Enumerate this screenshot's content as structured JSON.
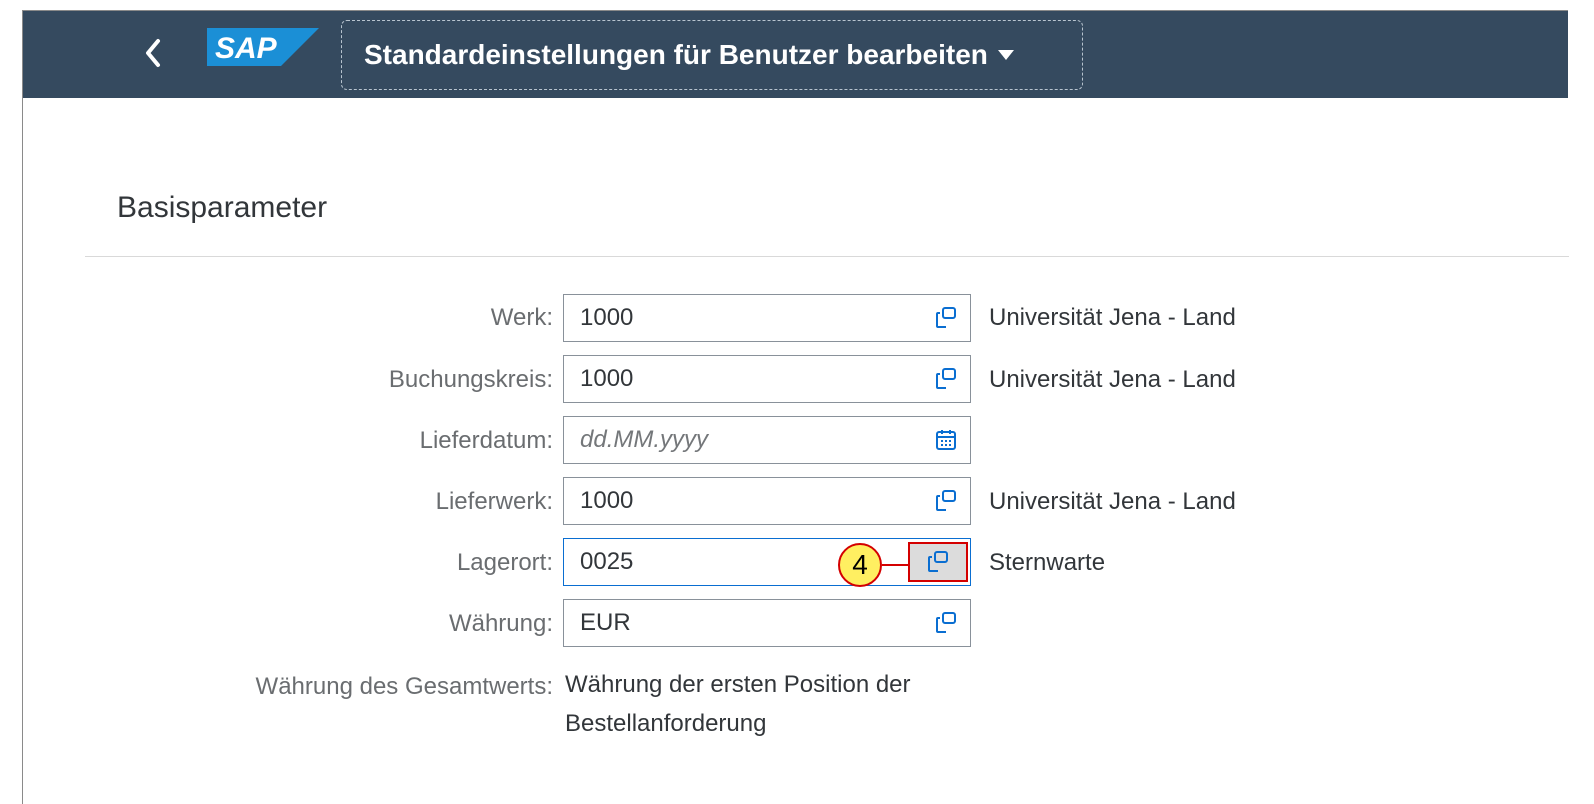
{
  "header": {
    "back_icon": "chevron-left-icon",
    "logo_text": "SAP",
    "title": "Standardeinstellungen für Benutzer bearbeiten",
    "colors": {
      "shell_bg": "#354a5f",
      "logo_blue": "#1b8fd6"
    }
  },
  "section": {
    "title": "Basisparameter"
  },
  "fields": [
    {
      "label": "Werk:",
      "value": "1000",
      "icon": "value-help-icon",
      "description": "Universität Jena - Land"
    },
    {
      "label": "Buchungskreis:",
      "value": "1000",
      "icon": "value-help-icon",
      "description": "Universität Jena - Land"
    },
    {
      "label": "Lieferdatum:",
      "placeholder": "dd.MM.yyyy",
      "icon": "calendar-icon"
    },
    {
      "label": "Lieferwerk:",
      "value": "1000",
      "icon": "value-help-icon",
      "description": "Universität Jena - Land"
    },
    {
      "label": "Lagerort:",
      "value": "0025",
      "icon": "value-help-icon",
      "description": "Sternwarte"
    },
    {
      "label": "Währung:",
      "value": "EUR",
      "icon": "value-help-icon"
    }
  ],
  "total_currency": {
    "label": "Währung des Gesamtwerts:",
    "line1": "Währung der ersten Position der",
    "line2": "Bestellanforderung"
  },
  "annotation": {
    "step": "4",
    "colors": {
      "fill": "#ffef61",
      "stroke": "#d40000"
    }
  }
}
